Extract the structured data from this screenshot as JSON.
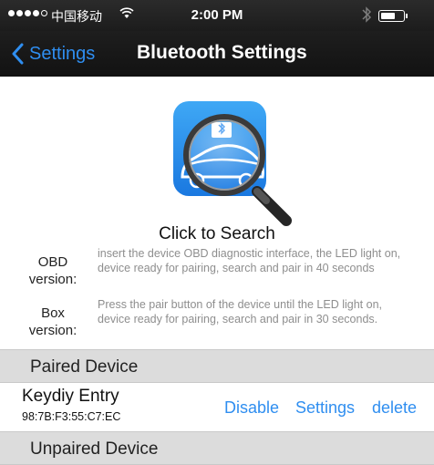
{
  "status_bar": {
    "carrier": "中国移动",
    "wifi_icon": "wifi-icon",
    "time": "2:00 PM",
    "bluetooth_icon": "bluetooth-icon",
    "battery_level": 0.65
  },
  "nav": {
    "back_label": "Settings",
    "title": "Bluetooth Settings"
  },
  "search": {
    "caption": "Click to Search"
  },
  "obd": {
    "label_line1": "OBD",
    "label_line2": "version:",
    "text": "insert the device OBD diagnostic interface, the LED light on, device ready for pairing, search and pair in 40 seconds"
  },
  "box": {
    "label_line1": "Box",
    "label_line2": "version:",
    "text": "Press the pair button of the device until the LED light on, device ready for pairing, search and pair in 30 seconds."
  },
  "paired": {
    "header": "Paired Device",
    "devices": [
      {
        "name": "Keydiy Entry",
        "mac": "98:7B:F3:55:C7:EC",
        "disable_label": "Disable",
        "settings_label": "Settings",
        "delete_label": "delete"
      }
    ]
  },
  "unpaired": {
    "header": "Unpaired Device"
  },
  "colors": {
    "accent": "#2f8ef0",
    "bar": "#1a1a1a",
    "section": "#dcdcdc",
    "hint": "#8e8e8e"
  }
}
